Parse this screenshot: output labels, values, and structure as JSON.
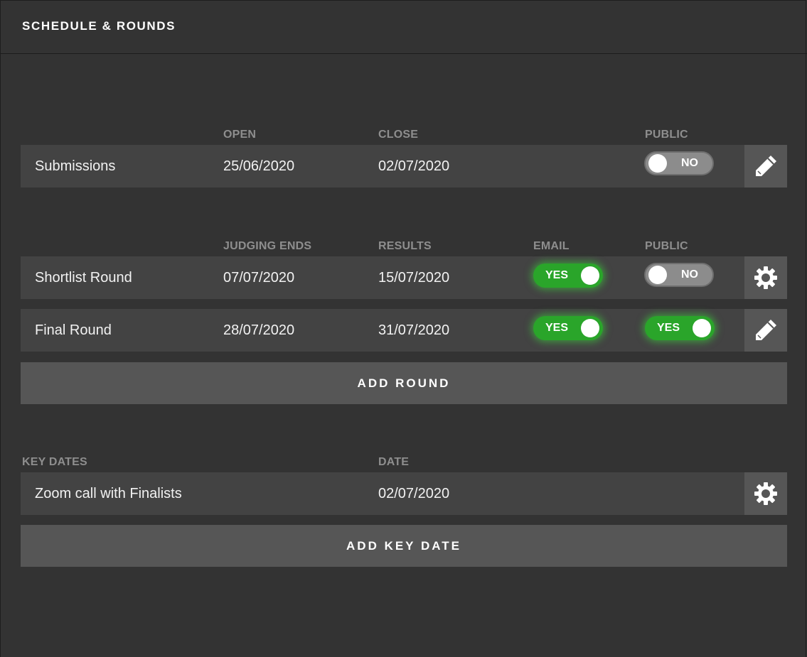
{
  "header": {
    "title": "SCHEDULE & ROUNDS"
  },
  "submissions": {
    "columns": {
      "open": "OPEN",
      "close": "CLOSE",
      "public": "PUBLIC"
    },
    "row": {
      "name": "Submissions",
      "open": "25/06/2020",
      "close": "02/07/2020",
      "public": {
        "state": "off",
        "label": "NO"
      },
      "action_icon": "pencil-icon"
    }
  },
  "rounds": {
    "columns": {
      "judging_ends": "JUDGING ENDS",
      "results": "RESULTS",
      "email": "EMAIL",
      "public": "PUBLIC"
    },
    "rows": [
      {
        "name": "Shortlist Round",
        "judging_ends": "07/07/2020",
        "results": "15/07/2020",
        "email": {
          "state": "on",
          "label": "YES"
        },
        "public": {
          "state": "off",
          "label": "NO"
        },
        "action_icon": "gear-icon"
      },
      {
        "name": "Final Round",
        "judging_ends": "28/07/2020",
        "results": "31/07/2020",
        "email": {
          "state": "on",
          "label": "YES"
        },
        "public": {
          "state": "on",
          "label": "YES"
        },
        "action_icon": "pencil-icon"
      }
    ],
    "add_label": "ADD ROUND"
  },
  "key_dates": {
    "columns": {
      "key_dates": "KEY DATES",
      "date": "DATE"
    },
    "rows": [
      {
        "name": "Zoom call with Finalists",
        "date": "02/07/2020",
        "action_icon": "gear-icon"
      }
    ],
    "add_label": "ADD KEY DATE"
  },
  "colors": {
    "background": "#333333",
    "row": "#434343",
    "button": "#565656",
    "toggle_on": "#2aa52a",
    "toggle_off": "#8c8c8c",
    "column_header": "#8e8e8e"
  }
}
